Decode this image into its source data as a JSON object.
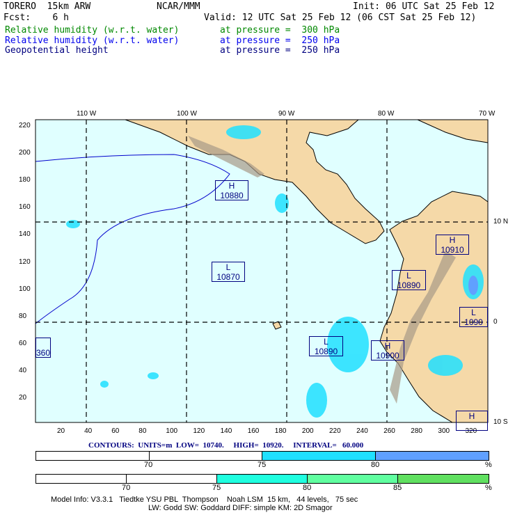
{
  "header": {
    "model": "TORERO  15km ARW",
    "org": "NCAR/MMM",
    "init": "Init: 06 UTC Sat 25 Feb 12",
    "fcst": "Fcst:    6 h",
    "valid": "Valid: 12 UTC Sat 25 Feb 12 (06 CST Sat 25 Feb 12)"
  },
  "fields": [
    {
      "name": "Relative humidity (w.r.t. water)",
      "level": "at pressure =  300 hPa",
      "color": "#008800"
    },
    {
      "name": "Relative humidity (w.r.t. water)",
      "level": "at pressure =  250 hPa",
      "color": "#0000ee"
    },
    {
      "name": "Geopotential height",
      "level": "at pressure =  250 hPa",
      "color": "#000080"
    }
  ],
  "map": {
    "lon_labels": [
      "110 W",
      "100 W",
      "90 W",
      "80 W",
      "70 W"
    ],
    "lat_labels": [
      "10 N",
      "0",
      "10 S"
    ],
    "y_ticks": [
      "220",
      "200",
      "180",
      "160",
      "140",
      "120",
      "100",
      "80",
      "60",
      "40",
      "20"
    ],
    "x_ticks": [
      "20",
      "40",
      "60",
      "80",
      "100",
      "120",
      "140",
      "160",
      "180",
      "200",
      "220",
      "240",
      "260",
      "280",
      "300",
      "320"
    ],
    "centers": [
      {
        "type": "H",
        "value": "10880"
      },
      {
        "type": "L",
        "value": "10870"
      },
      {
        "type": "L",
        "value": "10890"
      },
      {
        "type": "H",
        "value": "10900"
      },
      {
        "type": "L",
        "value": "10890"
      },
      {
        "type": "H",
        "value": "10910"
      },
      {
        "type": "L",
        "value": "1090"
      },
      {
        "type": "",
        "value": "360"
      },
      {
        "type": "H",
        "value": ""
      }
    ]
  },
  "contours": "CONTOURS:  UNITS=m  LOW=  10740.     HIGH=  10920.     INTERVAL=   60.000",
  "legend250": {
    "labels": [
      "70",
      "75",
      "80",
      "%"
    ],
    "colors": [
      "#ffffff",
      "#ffffff",
      "#20e0ff",
      "#60a0ff"
    ]
  },
  "legend300": {
    "labels": [
      "70",
      "75",
      "80",
      "85",
      "%"
    ],
    "colors": [
      "#ffffff",
      "#ffffff",
      "#20ffe0",
      "#60ffa0",
      "#60e060"
    ]
  },
  "footer": {
    "line1": "Model Info: V3.3.1   Tiedtke YSU PBL  Thompson    Noah LSM  15 km,   44 levels,   75 sec",
    "line2": "LW: Godd SW: Goddard DIFF: simple KM: 2D Smagor"
  }
}
